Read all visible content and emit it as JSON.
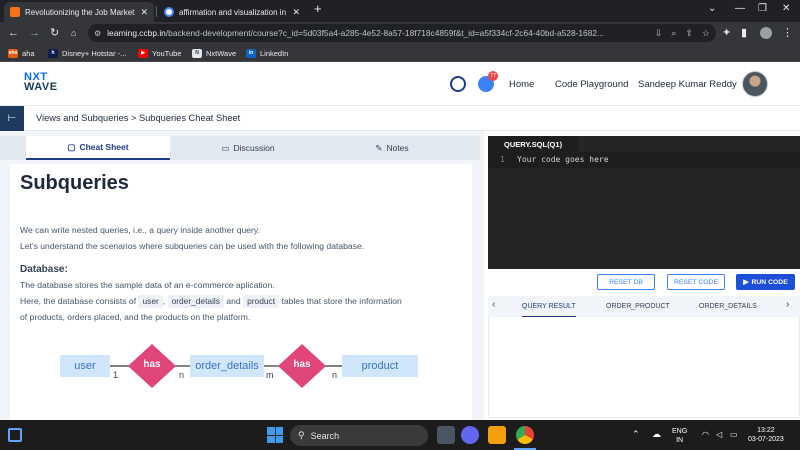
{
  "browser": {
    "tabs": [
      {
        "title": "Revolutionizing the Job Market |",
        "active": true
      },
      {
        "title": "affirmation and visualization in c",
        "active": false
      }
    ],
    "url_host": "learning.ccbp.in",
    "url_path": "/backend-development/course?c_id=5d03f5a4-a285-4e52-8a57-18f718c4859f&t_id=a5f334cf-2c64-40bd-a528-1682...",
    "bookmarks": [
      "aha",
      "Disney+ Hotstar -...",
      "YouTube",
      "NxtWave",
      "LinkedIn"
    ]
  },
  "header": {
    "logo_line1": "NXT",
    "logo_line2": "WAVE",
    "notif_count": "77",
    "nav": [
      "Home",
      "Code Playground"
    ],
    "user_name": "Sandeep Kumar Reddy"
  },
  "breadcrumb": "Views and Subqueries > Subqueries Cheat Sheet",
  "tabs": [
    "Cheat Sheet",
    "Discussion",
    "Notes"
  ],
  "content": {
    "title": "Subqueries",
    "intro1": "We can write nested queries, i.e., a query inside another query.",
    "intro2": "Let's understand the scenarios where subqueries can be used with the following database.",
    "db_heading": "Database:",
    "db1": "The database stores the sample data of an e-commerce aplication.",
    "db2_pre": "Here, the database consists of",
    "db2_t1": "user",
    "db2_sep1": ",",
    "db2_t2": "order_details",
    "db2_and": "and",
    "db2_t3": "product",
    "db2_post": "tables that store the information",
    "db3": "of products, orders placed, and the products on the platform."
  },
  "diagram": {
    "entities": [
      "user",
      "order_details",
      "product"
    ],
    "relations": [
      "has",
      "has"
    ],
    "cardinalities": [
      "1",
      "n",
      "m",
      "n"
    ]
  },
  "editor": {
    "tab_label": "QUERY.SQL(Q1)",
    "line_number": "1",
    "code_line": "Your code goes here",
    "buttons": {
      "reset_db": "RESET DB",
      "reset_code": "RESET CODE",
      "run_code": "RUN CODE"
    },
    "result_tabs": [
      "QUERY RESULT",
      "ORDER_PRODUCT",
      "ORDER_DETAILS"
    ]
  },
  "taskbar": {
    "search_placeholder": "Search",
    "lang1": "ENG",
    "lang2": "IN",
    "time": "13:22",
    "date": "03-07-2023"
  },
  "colors": {
    "brand_navy": "#1e3a5f",
    "accent_blue": "#1d4ed8",
    "diagram_relation": "#e0457b",
    "diagram_entity": "#cfe6fb"
  }
}
